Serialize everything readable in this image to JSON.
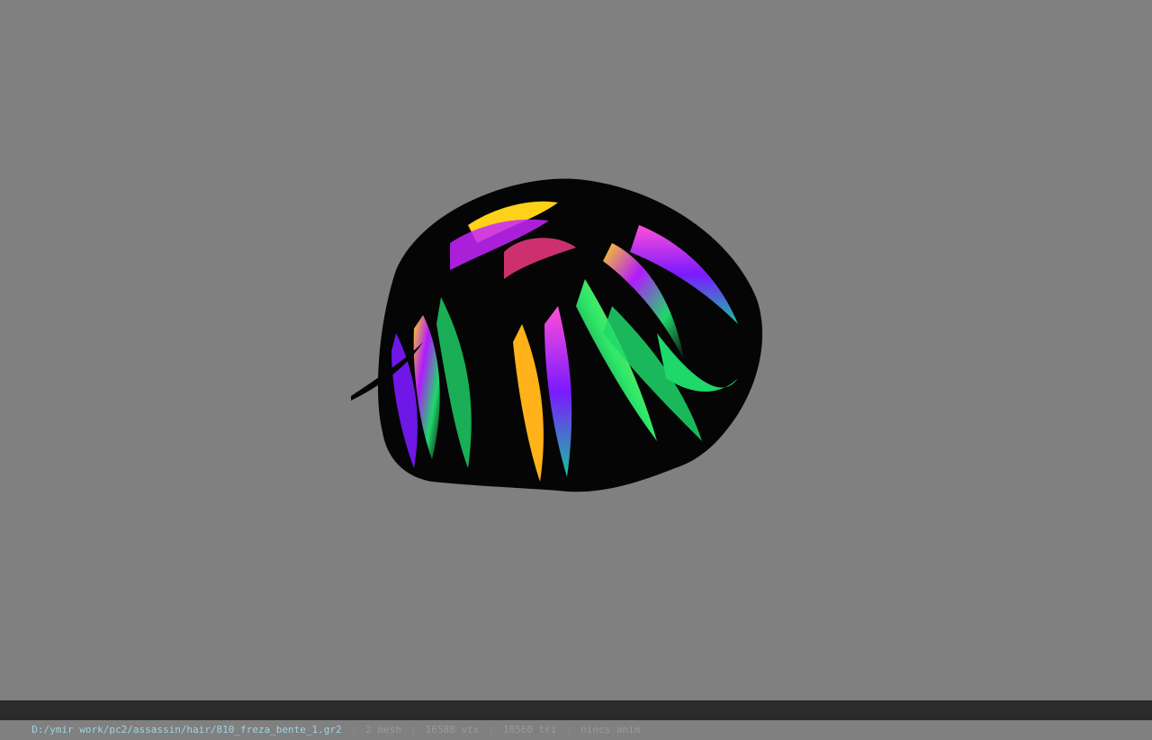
{
  "viewport": {
    "background_color": "#808080",
    "model_icon": "hair-mesh-preview"
  },
  "status_bar": {
    "file_path": "D:/ymir work/pc2/assassin/hair/810_freza_bente_1.gr2",
    "separator": "|",
    "mesh_count": "2 mesh",
    "vertex_count": "16588 vtx",
    "triangle_count": "10560 tri",
    "anim_status": "nincs anim",
    "path_color": "#9fd3e6",
    "background_color": "#2b2b2b"
  }
}
